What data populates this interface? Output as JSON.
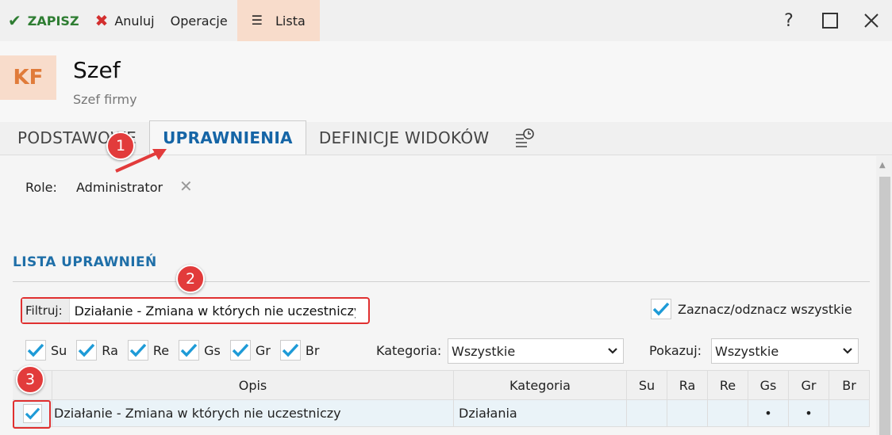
{
  "toolbar": {
    "save_label": "ZAPISZ",
    "cancel_label": "Anuluj",
    "operations_label": "Operacje",
    "list_label": "Lista",
    "help_label": "?"
  },
  "header": {
    "avatar": "KF",
    "title": "Szef",
    "subtitle": "Szef firmy"
  },
  "tabs": [
    {
      "label": "PODSTAWOWE"
    },
    {
      "label": "UPRAWNIENIA"
    },
    {
      "label": "DEFINICJE WIDOKÓW"
    }
  ],
  "role": {
    "label": "Role:",
    "value": "Administrator"
  },
  "section": {
    "title": "LISTA UPRAWNIEŃ"
  },
  "filter": {
    "label": "Filtruj:",
    "value": "Działanie - Zmiana w których nie uczestniczy"
  },
  "select_all": {
    "label": "Zaznacz/odznacz wszystkie"
  },
  "flags": [
    "Su",
    "Ra",
    "Re",
    "Gs",
    "Gr",
    "Br"
  ],
  "category": {
    "label": "Kategoria:",
    "value": "Wszystkie"
  },
  "show": {
    "label": "Pokazuj:",
    "value": "Wszystkie"
  },
  "table": {
    "headers": [
      "Opis",
      "Kategoria",
      "Su",
      "Ra",
      "Re",
      "Gs",
      "Gr",
      "Br"
    ],
    "rows": [
      {
        "opis": "Działanie - Zmiana w których nie uczestniczy",
        "kategoria": "Działania",
        "su": "",
        "ra": "",
        "re": "",
        "gs": "•",
        "gr": "•",
        "br": ""
      }
    ]
  },
  "callouts": [
    "1",
    "2",
    "3"
  ],
  "colors": {
    "accent_blue": "#1565a6",
    "check_blue": "#1e9bd7",
    "save_green": "#2e7d32",
    "cancel_red": "#d32f2f",
    "callout_red": "#e23b3b",
    "list_bg": "#f8dccb"
  }
}
